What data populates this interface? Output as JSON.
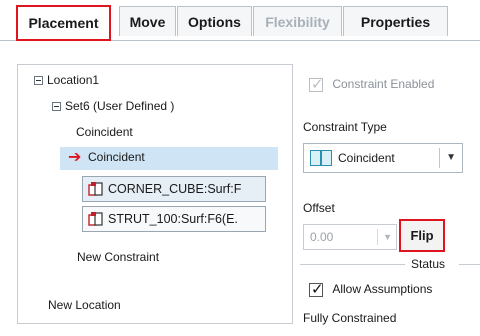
{
  "tabs": [
    {
      "label": "Placement",
      "state": "active"
    },
    {
      "label": "Move",
      "state": "normal"
    },
    {
      "label": "Options",
      "state": "normal"
    },
    {
      "label": "Flexibility",
      "state": "disabled"
    },
    {
      "label": "Properties",
      "state": "normal"
    }
  ],
  "tree": {
    "location": "Location1",
    "set": "Set6 (User Defined )",
    "constraint_1": "Coincident",
    "constraint_2_selected": "Coincident",
    "references": [
      "CORNER_CUBE:Surf:F",
      "STRUT_100:Surf:F6(E."
    ],
    "new_constraint": "New Constraint",
    "new_location": "New Location"
  },
  "constraint_enabled": {
    "label": "Constraint Enabled",
    "checked": true,
    "disabled": true
  },
  "constraint_type": {
    "label": "Constraint Type",
    "value": "Coincident"
  },
  "offset": {
    "label": "Offset",
    "value": "0.00",
    "flip_label": "Flip"
  },
  "status": {
    "legend": "Status",
    "allow_assumptions": {
      "label": "Allow Assumptions",
      "checked": true
    },
    "state_text": "Fully Constrained"
  },
  "colors": {
    "highlight_red": "#e0141e",
    "selection_blue": "#cfe4f4"
  }
}
